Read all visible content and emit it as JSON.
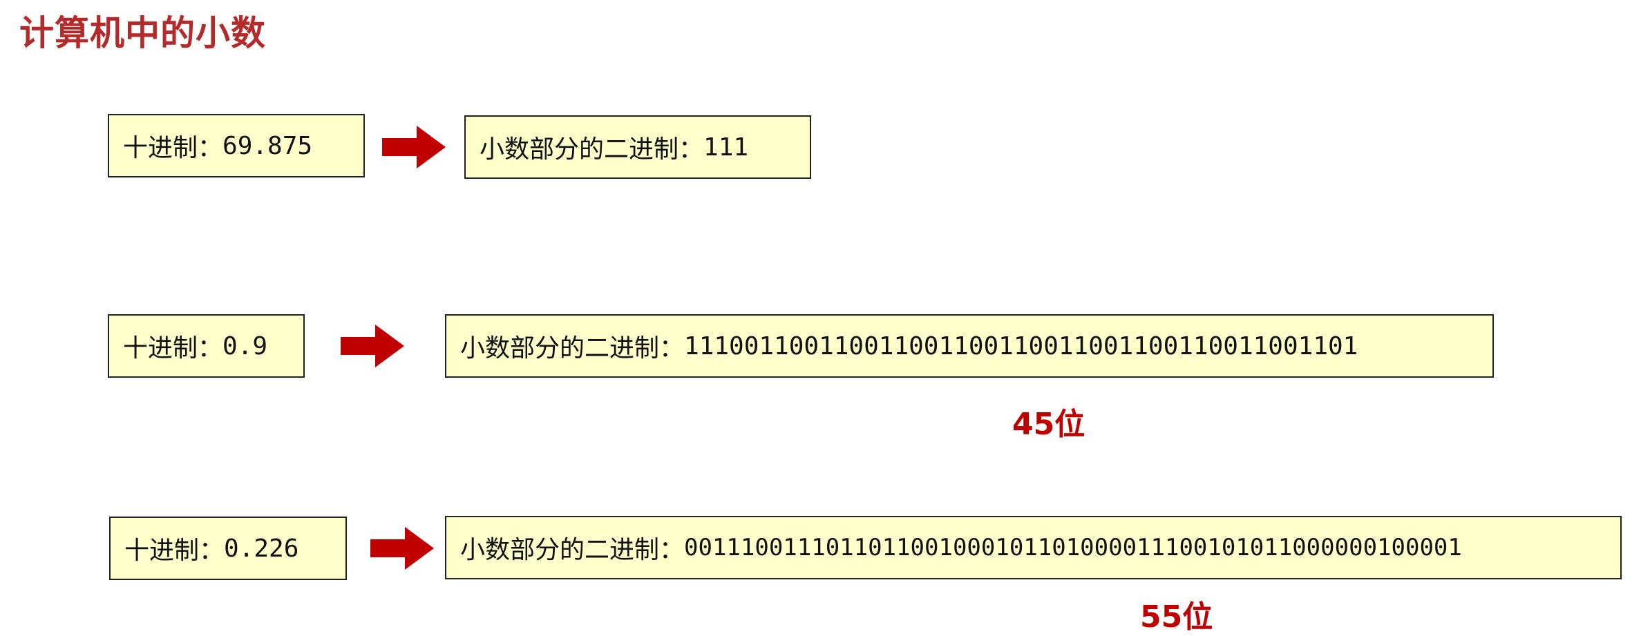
{
  "title": "计算机中的小数",
  "rows": [
    {
      "decimal_label": "十进制：",
      "decimal_value": "69.875",
      "binary_label": "小数部分的二进制：",
      "binary_value": "111",
      "bits_note": ""
    },
    {
      "decimal_label": "十进制：",
      "decimal_value": "0.9",
      "binary_label": "小数部分的二进制：",
      "binary_value": "111001100110011001100110011001100110011001101",
      "bits_note": "45位"
    },
    {
      "decimal_label": "十进制：",
      "decimal_value": "0.226",
      "binary_label": "小数部分的二进制：",
      "binary_value": "0011100111011011001000101101000011100101011000000100001",
      "bits_note": "55位"
    }
  ],
  "colors": {
    "title": "#b22a2a",
    "box_fill": "#ffffcc",
    "arrow": "#c00000",
    "note": "#c00000"
  },
  "icons": {
    "arrow": "right-arrow-icon"
  }
}
